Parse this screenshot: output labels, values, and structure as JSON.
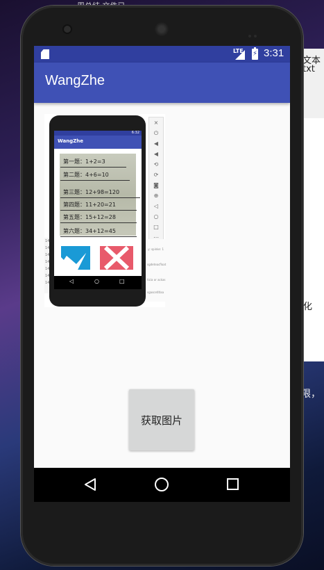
{
  "desktop": {
    "top_text": "一周总结 文件已...",
    "right_text_1": "文本",
    "right_text_2": "txt",
    "right_text_3": "化",
    "right_text_4": "限，"
  },
  "status_bar": {
    "network": "LTE",
    "time": "3:31"
  },
  "app_bar": {
    "title": "WangZhe"
  },
  "image_view": {
    "mini_app_title": "WangZhe",
    "mini_time": "6:32",
    "questions": [
      "第一题：1+2=3",
      "第二题：4+6=10",
      "第三题：12+98=120",
      "第四题：11+20=21",
      "第五题：15+12=28",
      "第六题：34+12=45"
    ]
  },
  "main": {
    "get_image_button": "获取图片"
  },
  "colors": {
    "status_bar": "#303f9f",
    "app_bar": "#3f51b5",
    "check": "#1a9ad6",
    "cross": "#e85a6b"
  }
}
